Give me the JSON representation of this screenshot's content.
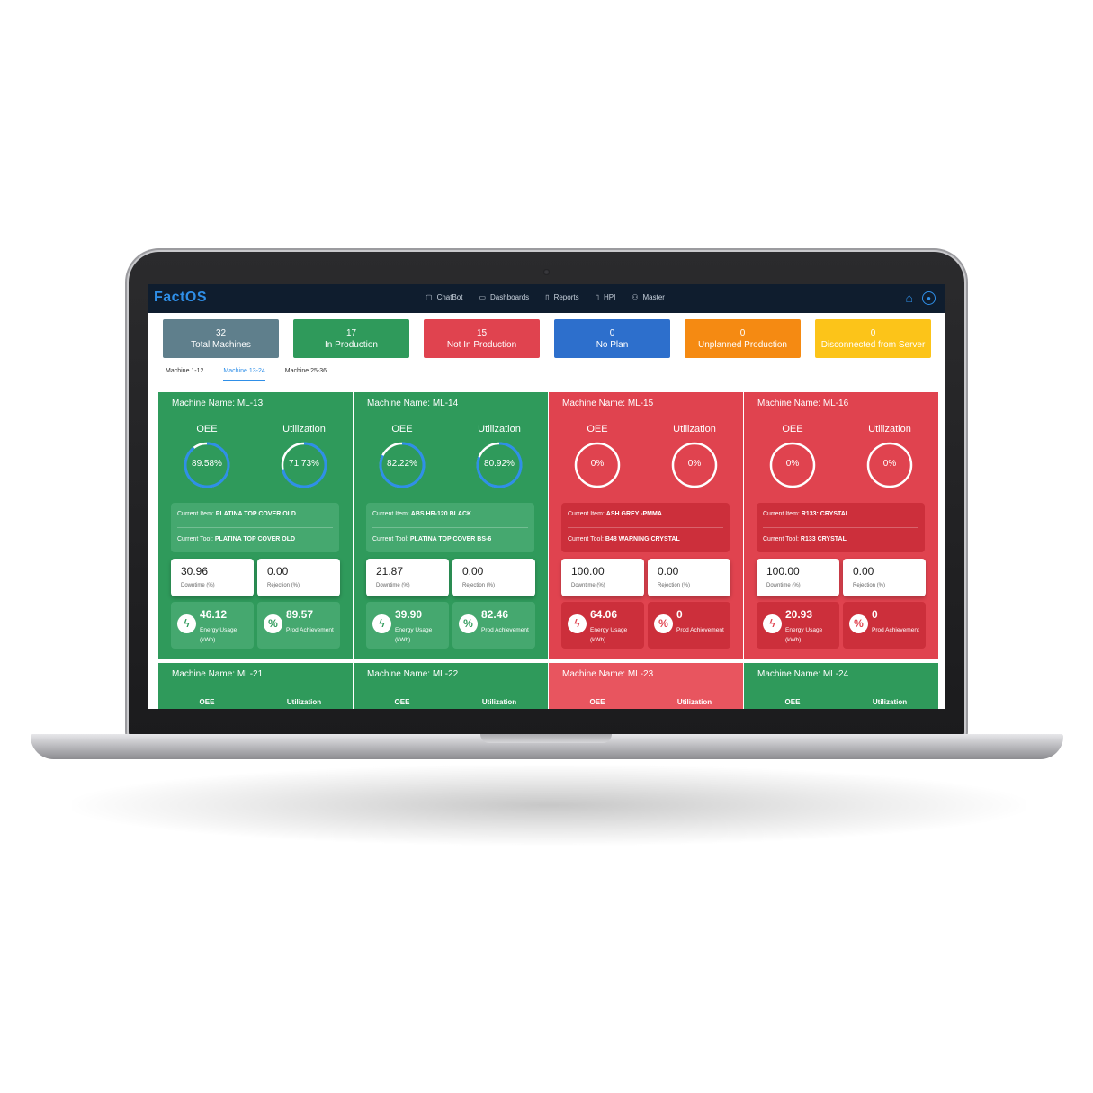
{
  "app": {
    "logo": "FactOS"
  },
  "nav": [
    {
      "label": "ChatBot",
      "icon": "chat-icon",
      "glyph": "▢"
    },
    {
      "label": "Dashboards",
      "icon": "monitor-icon",
      "glyph": "▭"
    },
    {
      "label": "Reports",
      "icon": "report-icon",
      "glyph": "▯"
    },
    {
      "label": "HPI",
      "icon": "document-icon",
      "glyph": "▯"
    },
    {
      "label": "Master",
      "icon": "user-icon",
      "glyph": "⚇"
    }
  ],
  "stats": [
    {
      "count": "32",
      "label": "Total Machines",
      "color": "#5f7f8c"
    },
    {
      "count": "17",
      "label": "In Production",
      "color": "#2f9a5b"
    },
    {
      "count": "15",
      "label": "Not In Production",
      "color": "#e0434f"
    },
    {
      "count": "0",
      "label": "No Plan",
      "color": "#2d6fcc"
    },
    {
      "count": "0",
      "label": "Unplanned  Production",
      "color": "#f58a12"
    },
    {
      "count": "0",
      "label": "Disconnected from Server",
      "color": "#fcc419"
    }
  ],
  "tabs": [
    {
      "label": "Machine 1-12",
      "active": false
    },
    {
      "label": "Machine 13-24",
      "active": true
    },
    {
      "label": "Machine 25-36",
      "active": false
    }
  ],
  "labels": {
    "machine_prefix": "Machine Name: ",
    "oee": "OEE",
    "utilization": "Utilization",
    "current_item": "Current Item: ",
    "current_tool": "Current Tool: ",
    "downtime": "Downtime (%)",
    "rejection": "Rejection (%)",
    "energy": "Energy Usage (kWh)",
    "prod": "Prod Achievement"
  },
  "machines": [
    {
      "name": "ML-13",
      "status": "green",
      "oee": "89.58%",
      "oee_pct": 89.58,
      "utilization": "71.73%",
      "util_pct": 71.73,
      "item": "PLATINA TOP COVER OLD",
      "tool": "PLATINA TOP COVER OLD",
      "downtime": "30.96",
      "rejection": "0.00",
      "energy": "46.12",
      "prod": "89.57"
    },
    {
      "name": "ML-14",
      "status": "green",
      "oee": "82.22%",
      "oee_pct": 82.22,
      "utilization": "80.92%",
      "util_pct": 80.92,
      "item": "ABS HR-120 BLACK",
      "tool": "PLATINA TOP COVER BS-6",
      "downtime": "21.87",
      "rejection": "0.00",
      "energy": "39.90",
      "prod": "82.46"
    },
    {
      "name": "ML-15",
      "status": "red",
      "oee": "0%",
      "oee_pct": 0,
      "utilization": "0%",
      "util_pct": 0,
      "item": "ASH GREY -PMMA",
      "tool": "B48 WARNING CRYSTAL",
      "downtime": "100.00",
      "rejection": "0.00",
      "energy": "64.06",
      "prod": "0"
    },
    {
      "name": "ML-16",
      "status": "red",
      "oee": "0%",
      "oee_pct": 0,
      "utilization": "0%",
      "util_pct": 0,
      "item": "R133: CRYSTAL",
      "tool": "R133 CRYSTAL",
      "downtime": "100.00",
      "rejection": "0.00",
      "energy": "20.93",
      "prod": "0"
    }
  ],
  "machines_row2": [
    {
      "name": "ML-21",
      "status": "green"
    },
    {
      "name": "ML-22",
      "status": "green"
    },
    {
      "name": "ML-23",
      "status": "red"
    },
    {
      "name": "ML-24",
      "status": "green"
    }
  ],
  "colors": {
    "accent": "#2f8fe8",
    "green": "#2f9a5b",
    "red": "#e0434f",
    "gauge_track": "#ffffff",
    "gauge_fill": "#2f8fe8"
  }
}
